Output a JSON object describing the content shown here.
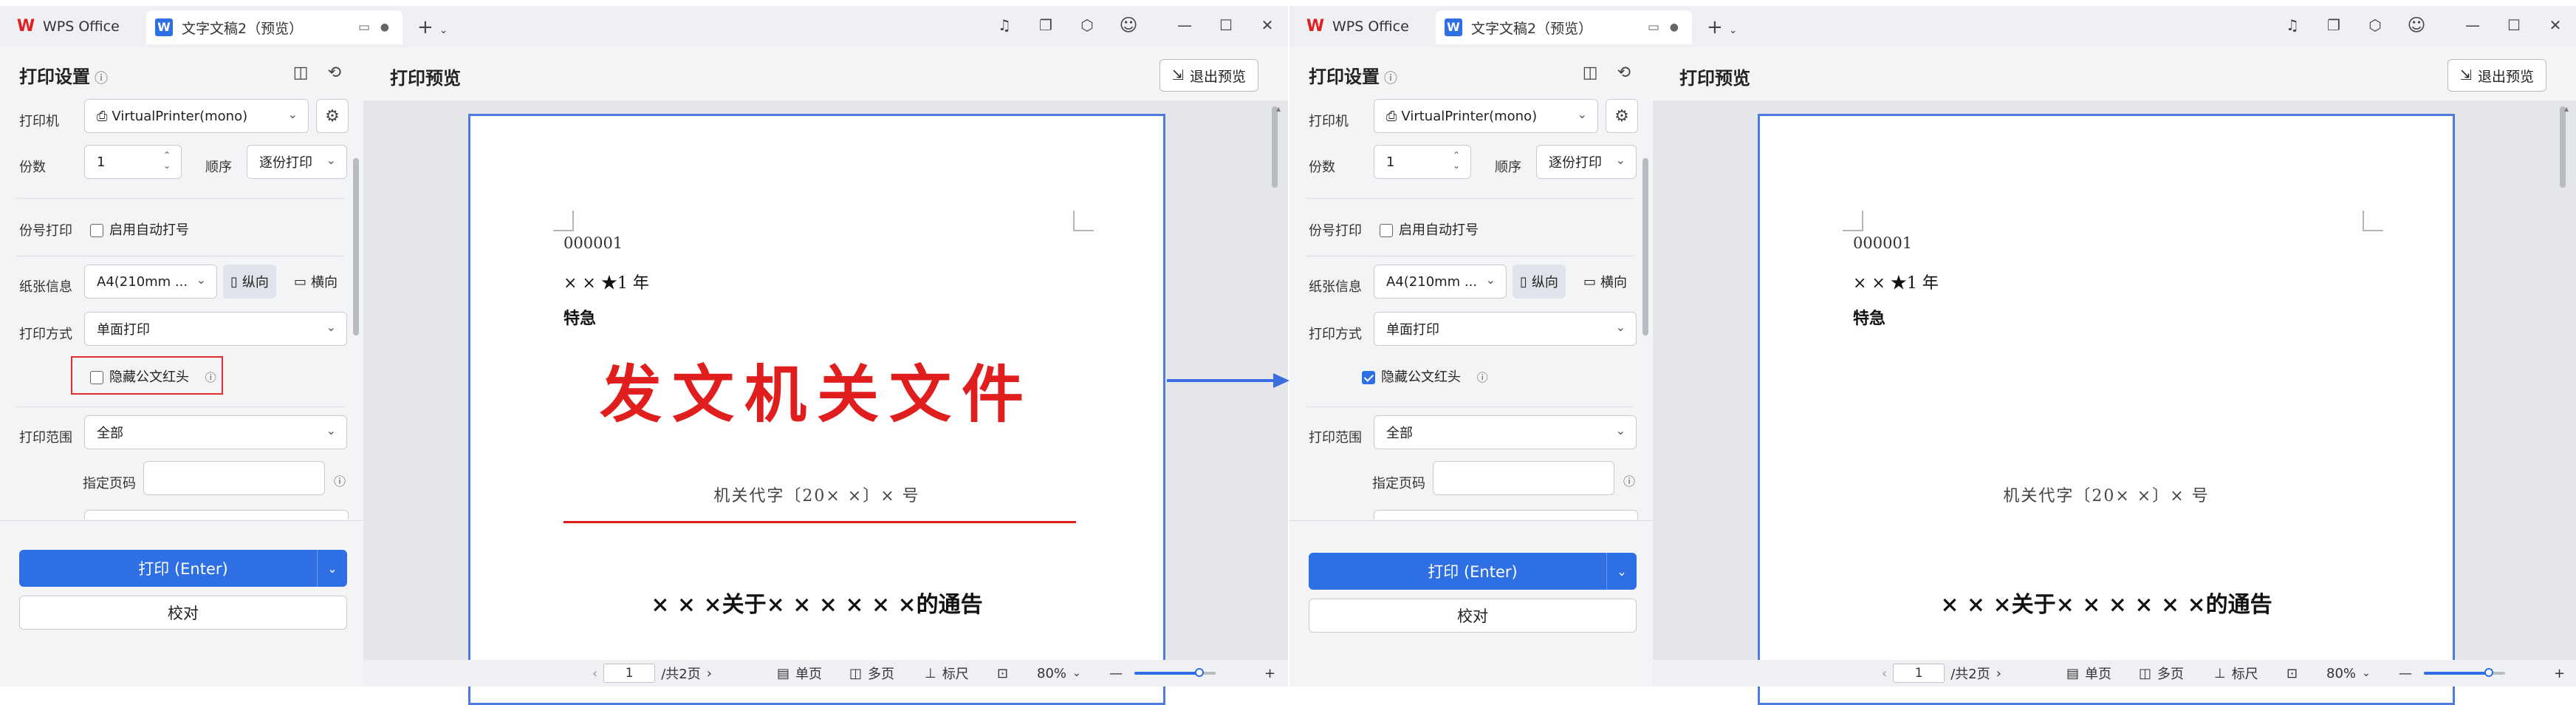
{
  "app": {
    "home_tab": "WPS Office",
    "doc_tab": "文字文稿2（预览）",
    "new_tab_symbol": "+",
    "window_controls": [
      "—",
      "☐",
      "✕"
    ]
  },
  "sidebar": {
    "title": "打印设置",
    "printer_label": "打印机",
    "printer_value": "VirtualPrinter(mono)",
    "copies_label": "份数",
    "copies_value": "1",
    "order_label": "顺序",
    "order_value": "逐份打印",
    "copy_number_label": "份号打印",
    "auto_number_label": "启用自动打号",
    "paper_label": "纸张信息",
    "paper_value": "A4(210mm ...",
    "portrait_label": "纵向",
    "landscape_label": "横向",
    "print_mode_label": "打印方式",
    "print_mode_value": "单面打印",
    "hide_header_label": "隐藏公文红头",
    "range_label": "打印范围",
    "range_value": "全部",
    "pages_label": "指定页码",
    "print_button": "打印 (Enter)",
    "proof_button": "校对"
  },
  "preview": {
    "title": "打印预览",
    "exit_button": "退出预览",
    "document": {
      "serial": "000001",
      "year_line": "× × ★1 年",
      "urgency": "特急",
      "issuer": "发文机关文件",
      "issue_code": "机关代字〔20× ×〕× 号",
      "notice_title": "× × ×关于× × × × × ×的通告"
    }
  },
  "status": {
    "page_current": "1",
    "page_total": "/共2页",
    "single_page": "单页",
    "multi_page": "多页",
    "ruler": "标尺",
    "zoom": "80%",
    "zoom_minus": "—",
    "zoom_plus": "+",
    "zoom_fraction": 0.8
  },
  "panes": [
    {
      "hide_header_checked": false,
      "show_red_header": true
    },
    {
      "hide_header_checked": true,
      "show_red_header": false
    }
  ],
  "colors": {
    "accent": "#2f6fe4",
    "red_header": "#e01e1e",
    "highlight_box": "#e0302c",
    "arrow": "#3b6de0"
  }
}
